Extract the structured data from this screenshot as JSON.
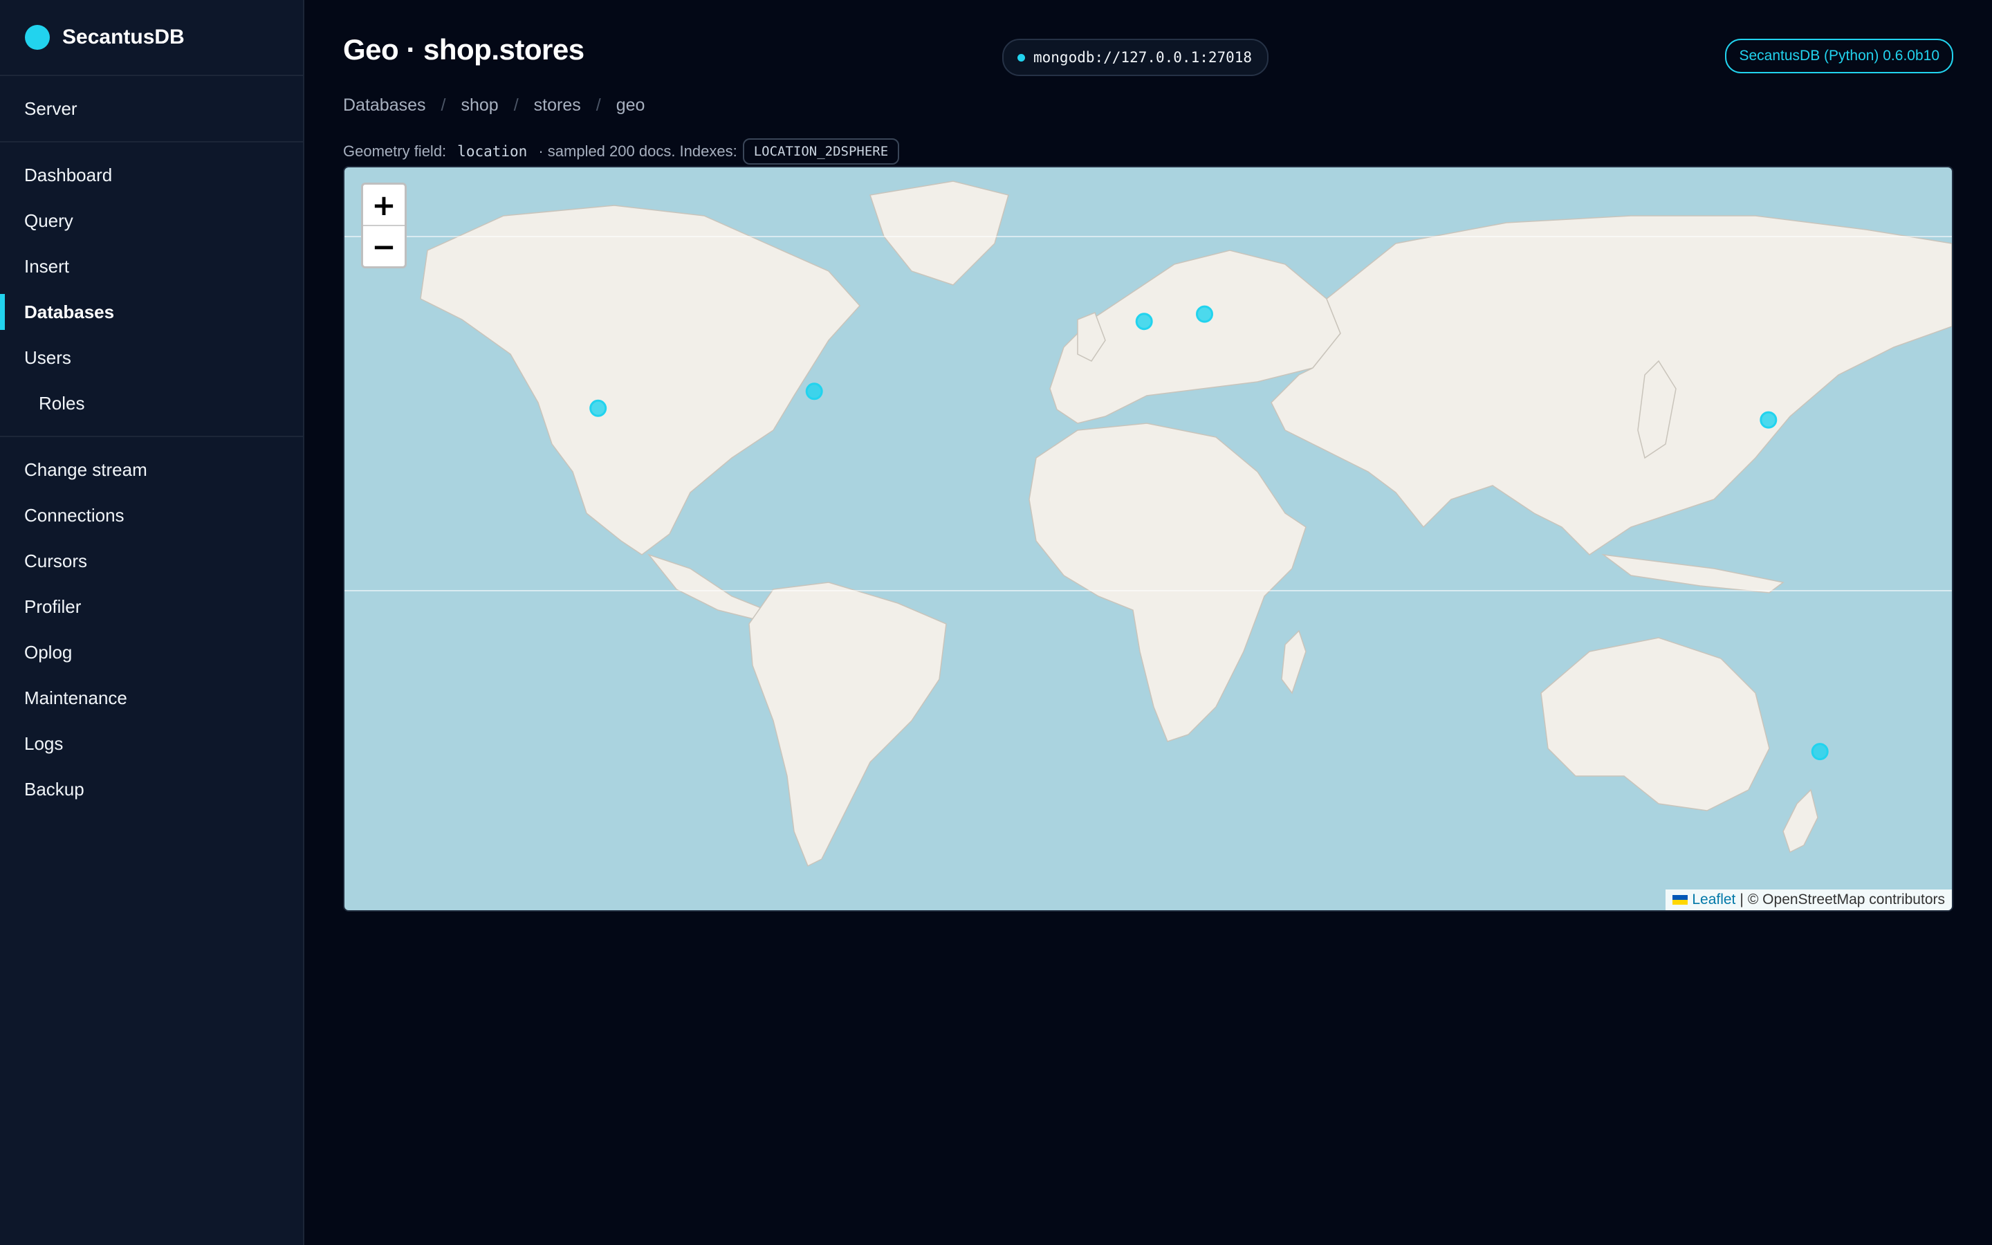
{
  "brand": {
    "name": "SecantusDB",
    "accent": "#22d3ee"
  },
  "sidebar": {
    "groups": [
      {
        "items": [
          {
            "label": "Server"
          }
        ]
      },
      {
        "items": [
          {
            "label": "Dashboard"
          },
          {
            "label": "Query"
          },
          {
            "label": "Insert"
          },
          {
            "label": "Databases",
            "active": true
          },
          {
            "label": "Users"
          },
          {
            "label": "Roles"
          }
        ]
      },
      {
        "items": [
          {
            "label": "Change stream"
          },
          {
            "label": "Connections"
          },
          {
            "label": "Cursors"
          },
          {
            "label": "Profiler"
          },
          {
            "label": "Oplog"
          },
          {
            "label": "Maintenance"
          },
          {
            "label": "Logs"
          },
          {
            "label": "Backup"
          }
        ]
      }
    ]
  },
  "header": {
    "title": "Geo · shop.stores",
    "connection": "mongodb://127.0.0.1:27018",
    "version": "SecantusDB (Python) 0.6.0b10"
  },
  "breadcrumb": [
    "Databases",
    "shop",
    "stores",
    "geo"
  ],
  "geo": {
    "field_label": "Geometry field:",
    "field_name": "location",
    "sampled_text": "· sampled 200 docs. Indexes:",
    "index_name": "LOCATION_2DSPHERE"
  },
  "map": {
    "zoom_in": "+",
    "zoom_out": "−",
    "attribution_link": "Leaflet",
    "attribution_sep": "|",
    "attribution_text": "© OpenStreetMap contributors",
    "marker_color": "#22d3ee",
    "water_color": "#aad3df",
    "land_color": "#f2efe9",
    "markers": [
      {
        "lat": 37.77,
        "lon": -122.42
      },
      {
        "lat": 40.71,
        "lon": -74.01
      },
      {
        "lat": 51.51,
        "lon": -0.13
      },
      {
        "lat": 52.52,
        "lon": 13.4
      },
      {
        "lat": 35.68,
        "lon": 139.69
      },
      {
        "lat": -33.87,
        "lon": 151.21
      }
    ]
  }
}
